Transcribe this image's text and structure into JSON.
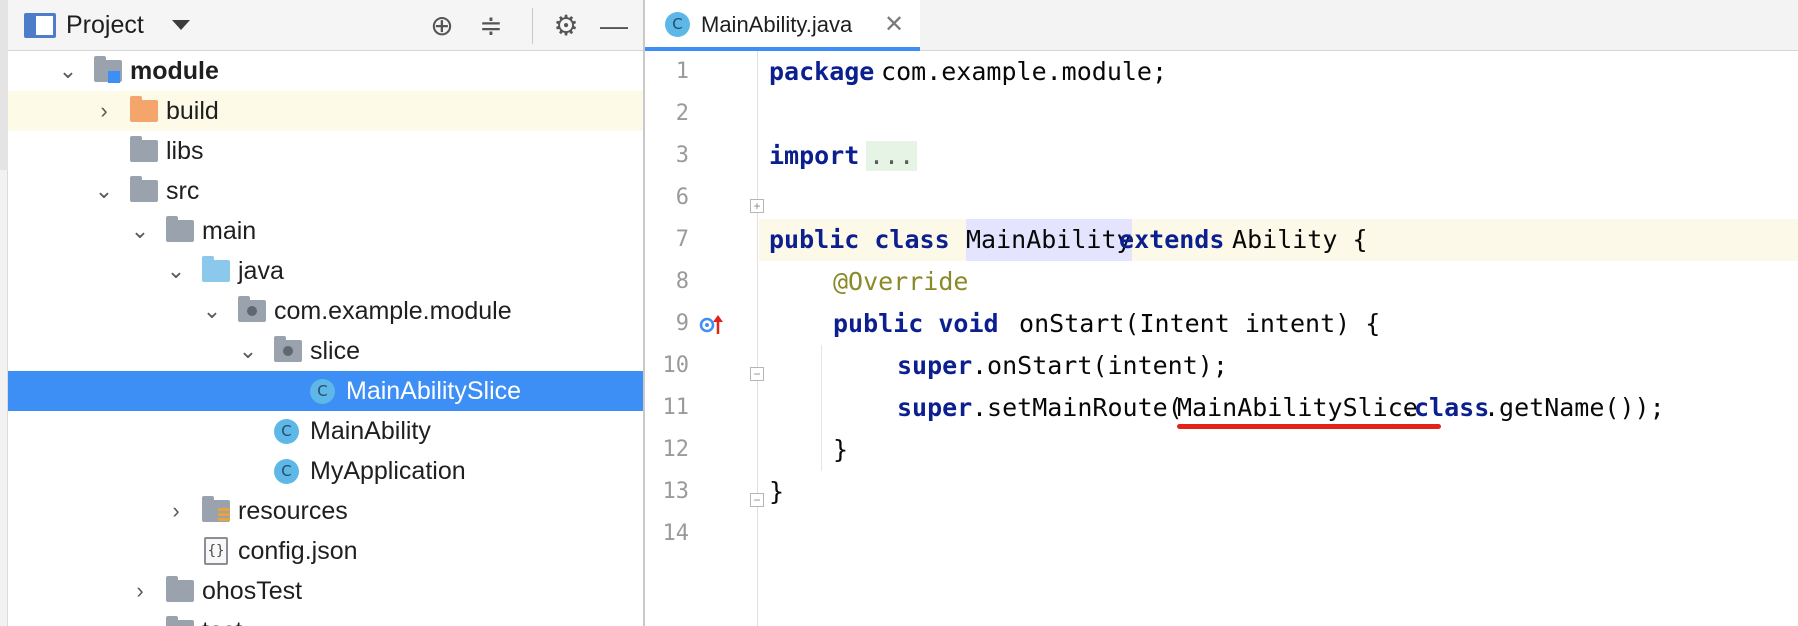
{
  "project_panel": {
    "title": "Project",
    "tree": [
      {
        "label": "module",
        "bold": true,
        "icon": "module-folder-icon",
        "expanded": true
      },
      {
        "label": "build",
        "icon": "folder-orange-icon",
        "expanded": false
      },
      {
        "label": "libs",
        "icon": "folder-icon"
      },
      {
        "label": "src",
        "icon": "folder-icon",
        "expanded": true
      },
      {
        "label": "main",
        "icon": "folder-icon",
        "expanded": true
      },
      {
        "label": "java",
        "icon": "folder-blue-icon",
        "expanded": true
      },
      {
        "label": "com.example.module",
        "icon": "package-icon",
        "expanded": true
      },
      {
        "label": "slice",
        "icon": "package-icon",
        "expanded": true
      },
      {
        "label": "MainAbilitySlice",
        "icon": "class-icon",
        "selected": true
      },
      {
        "label": "MainAbility",
        "icon": "class-icon"
      },
      {
        "label": "MyApplication",
        "icon": "class-icon"
      },
      {
        "label": "resources",
        "icon": "resources-folder-icon",
        "expanded": false
      },
      {
        "label": "config.json",
        "icon": "json-file-icon"
      },
      {
        "label": "ohosTest",
        "icon": "folder-icon",
        "expanded": false
      },
      {
        "label": "test",
        "icon": "folder-icon",
        "expanded": false
      }
    ]
  },
  "editor": {
    "tab": {
      "label": "MainAbility.java",
      "icon_letter": "C"
    },
    "line_numbers": [
      "1",
      "2",
      "3",
      "6",
      "7",
      "8",
      "9",
      "10",
      "11",
      "12",
      "13",
      "14"
    ],
    "code": {
      "l1_kw": "package",
      "l1_rest": " com.example.module;",
      "l3_kw": "import",
      "l3_dots": "...",
      "l7_kw": "public class ",
      "l7_cls": "MainAbility",
      "l7_ext": " extends",
      "l7_rest": " Ability {",
      "l8_ann": "@Override",
      "l9_kw": "public void",
      "l9_rest": " onStart(Intent intent) {",
      "l10_kw": "super",
      "l10_rest": ".onStart(intent);",
      "l11_kw": "super",
      "l11_mid": ".setMainRoute(",
      "l11_slice": "MainAbilitySlice",
      "l11_dot": ".",
      "l11_class": "class",
      "l11_rest": ".getName());",
      "l12": "}",
      "l13": "}"
    }
  },
  "colors": {
    "selection": "#3d8ef5",
    "keyword": "#0b1f8f",
    "annotation": "#8a8a2a",
    "error_underline": "#e2231a"
  }
}
